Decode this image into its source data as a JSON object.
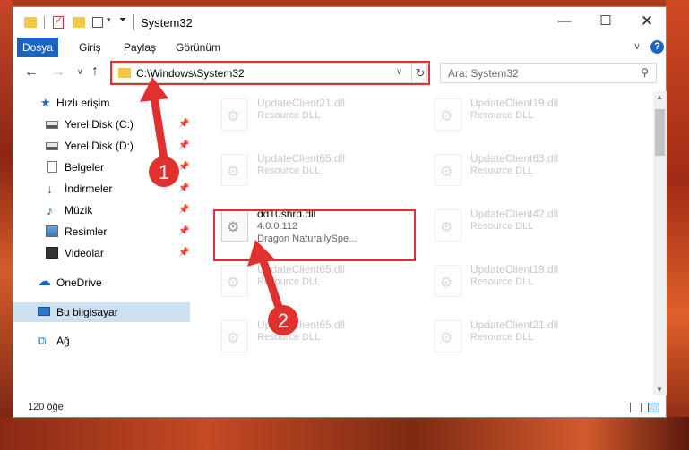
{
  "window": {
    "title": "System32",
    "controls": {
      "minimize": "—",
      "maximize": "☐",
      "close": "✕"
    }
  },
  "ribbon": {
    "tabs": [
      "Dosya",
      "Giriş",
      "Paylaş",
      "Görünüm"
    ],
    "active_tab": "Dosya",
    "accent": "#1a65c0"
  },
  "address_bar": {
    "path": "C:\\Windows\\System32",
    "search_placeholder": "Ara: System32"
  },
  "nav_pane": {
    "items": [
      {
        "label": "Hızlı erişim",
        "icon": "star-icon"
      },
      {
        "label": "Yerel Disk (C:)",
        "icon": "drive-icon",
        "pinned": true
      },
      {
        "label": "Yerel Disk (D:)",
        "icon": "drive-icon",
        "pinned": true
      },
      {
        "label": "Belgeler",
        "icon": "documents-icon",
        "pinned": true
      },
      {
        "label": "İndirmeler",
        "icon": "downloads-icon",
        "pinned": true
      },
      {
        "label": "Müzik",
        "icon": "music-icon",
        "pinned": true
      },
      {
        "label": "Resimler",
        "icon": "pictures-icon",
        "pinned": true
      },
      {
        "label": "Videolar",
        "icon": "videos-icon",
        "pinned": true
      },
      {
        "label": "OneDrive",
        "icon": "cloud-icon"
      },
      {
        "label": "Bu bilgisayar",
        "icon": "computer-icon",
        "selected": true
      },
      {
        "label": "Ağ",
        "icon": "network-icon"
      }
    ]
  },
  "files": [
    {
      "name": "UpdateClient21.dll",
      "type": "Resource DLL"
    },
    {
      "name": "UpdateClient19.dll",
      "type": "Resource DLL"
    },
    {
      "name": "UpdateClient65.dll",
      "type": "Resource DLL"
    },
    {
      "name": "UpdateClient63.dll",
      "type": "Resource DLL"
    },
    {
      "name": "dd10shrd.dll",
      "version": "4.0.0.112",
      "company": "Dragon NaturallySpe...",
      "highlighted": true
    },
    {
      "name": "UpdateClient42.dll",
      "type": "Resource DLL"
    },
    {
      "name": "UpdateClient65.dll",
      "type": "Resource DLL"
    },
    {
      "name": "UpdateClient19.dll",
      "type": "Resource DLL"
    },
    {
      "name": "UpdateClient65.dll",
      "type": "Resource DLL"
    },
    {
      "name": "UpdateClient21.dll",
      "type": "Resource DLL"
    }
  ],
  "status_bar": {
    "item_count": "120 öğe"
  },
  "annotations": {
    "step1": "1",
    "step2": "2",
    "color": "#e0312f"
  }
}
